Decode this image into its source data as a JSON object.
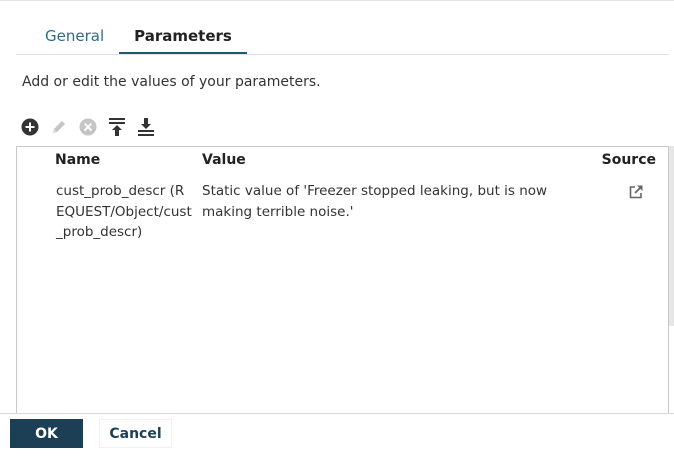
{
  "tabs": [
    {
      "label": "General",
      "active": false
    },
    {
      "label": "Parameters",
      "active": true
    }
  ],
  "description": "Add or edit the values of your parameters.",
  "toolbar": {
    "icons": [
      "add-icon",
      "edit-icon",
      "remove-icon",
      "move-up-icon",
      "move-down-icon"
    ]
  },
  "table": {
    "columns": {
      "name": "Name",
      "value": "Value",
      "source": "Source"
    },
    "rows": [
      {
        "name": "cust_prob_descr (REQUEST/Object/cust_prob_descr)",
        "value": "Static value of 'Freezer stopped leaking, but is now making terrible noise.'",
        "source_icon": "external-link-icon"
      }
    ]
  },
  "footer": {
    "ok_label": "OK",
    "cancel_label": "Cancel"
  },
  "colors": {
    "accent": "#1d3f55",
    "tab_link": "#2d6e80"
  }
}
